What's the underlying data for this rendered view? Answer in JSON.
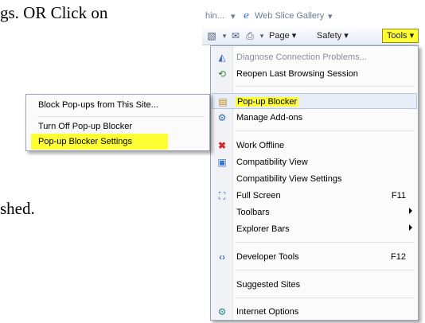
{
  "document": {
    "line1": "gs. OR Click on",
    "line2": "shed."
  },
  "favorites_bar": {
    "left_fragment": "hin...",
    "web_slice": "Web Slice Gallery"
  },
  "command_bar": {
    "page": "Page",
    "safety": "Safety",
    "tools": "Tools"
  },
  "tools_menu": {
    "items": [
      {
        "label": "Diagnose Connection Problems...",
        "icon": "diagnose-icon"
      },
      {
        "label": "Reopen Last Browsing Session",
        "icon": "reopen-icon"
      },
      {
        "label": "Pop-up Blocker",
        "icon": "popup-blocker-icon"
      },
      {
        "label": "Manage Add-ons",
        "icon": "addons-icon"
      },
      {
        "label": "Work Offline",
        "icon": "work-offline-icon"
      },
      {
        "label": "Compatibility View",
        "icon": "compat-view-icon"
      },
      {
        "label": "Compatibility View Settings"
      },
      {
        "label": "Full Screen",
        "shortcut": "F11",
        "icon": "fullscreen-icon"
      },
      {
        "label": "Toolbars"
      },
      {
        "label": "Explorer Bars"
      },
      {
        "label": "Developer Tools",
        "shortcut": "F12",
        "icon": "developer-tools-icon"
      },
      {
        "label": "Suggested Sites"
      },
      {
        "label": "Internet Options",
        "icon": "internet-options-icon"
      }
    ]
  },
  "popup_submenu": {
    "items": [
      {
        "label": "Block Pop-ups from This Site..."
      },
      {
        "label": "Turn Off Pop-up Blocker"
      },
      {
        "label": "Pop-up Blocker Settings"
      }
    ]
  },
  "colors": {
    "highlight": "#ffff33",
    "menu_border": "#9aa3b1"
  }
}
